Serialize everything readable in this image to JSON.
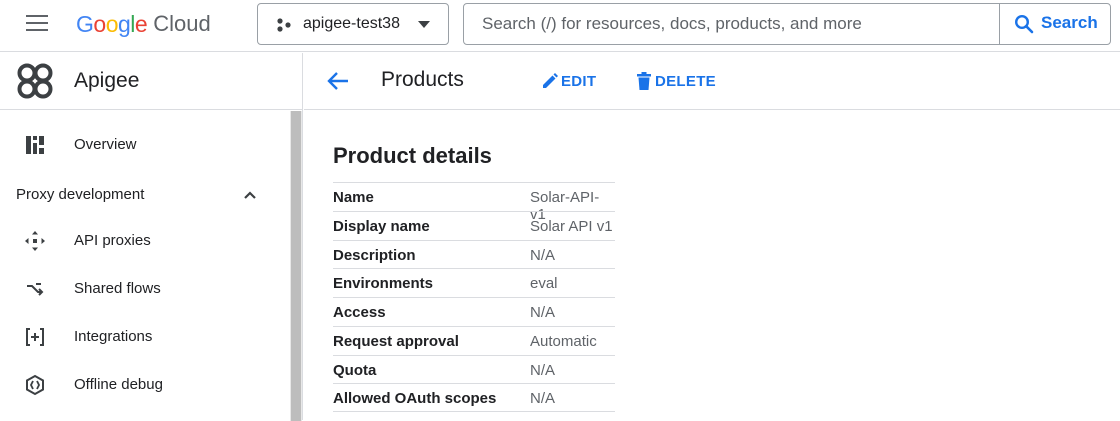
{
  "topbar": {
    "logo_google": "Google",
    "logo_cloud": "Cloud",
    "project": "apigee-test38",
    "search_placeholder": "Search (/) for resources, docs, products, and more",
    "search_button": "Search"
  },
  "sidebar": {
    "title": "Apigee",
    "overview": "Overview",
    "section": "Proxy development",
    "items": [
      {
        "label": "API proxies",
        "icon": "api-proxies-icon"
      },
      {
        "label": "Shared flows",
        "icon": "shared-flows-icon"
      },
      {
        "label": "Integrations",
        "icon": "integrations-icon"
      },
      {
        "label": "Offline debug",
        "icon": "offline-debug-icon"
      }
    ]
  },
  "main": {
    "title": "Products",
    "edit_label": "EDIT",
    "delete_label": "DELETE",
    "section_title": "Product details",
    "details": [
      {
        "key": "Name",
        "value": "Solar-API-v1"
      },
      {
        "key": "Display name",
        "value": "Solar API v1"
      },
      {
        "key": "Description",
        "value": "N/A"
      },
      {
        "key": "Environments",
        "value": "eval"
      },
      {
        "key": "Access",
        "value": "N/A"
      },
      {
        "key": "Request approval",
        "value": "Automatic"
      },
      {
        "key": "Quota",
        "value": "N/A"
      },
      {
        "key": "Allowed OAuth scopes",
        "value": "N/A"
      }
    ]
  },
  "colors": {
    "accent": "#1a73e8",
    "text": "#202124",
    "muted": "#5f6368",
    "divider": "#dadce0"
  }
}
